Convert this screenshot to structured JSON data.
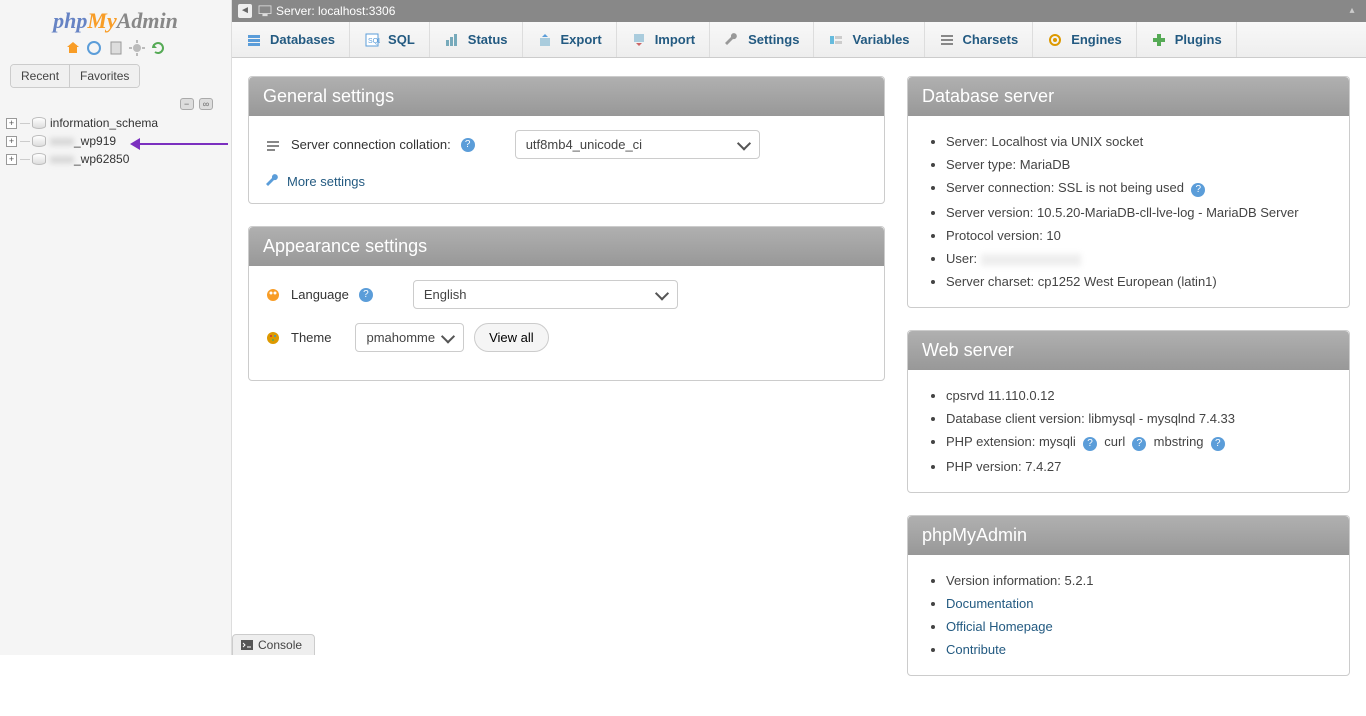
{
  "logo": {
    "php": "php",
    "my": "My",
    "admin": "Admin"
  },
  "sidebar": {
    "tabs": {
      "recent": "Recent",
      "favorites": "Favorites"
    },
    "databases": [
      {
        "name": "information_schema",
        "prefix": ""
      },
      {
        "name": "_wp919",
        "prefix": "xxxx"
      },
      {
        "name": "_wp62850",
        "prefix": "xxxx"
      }
    ]
  },
  "topbar": {
    "server_label": "Server: localhost:3306"
  },
  "tabs": [
    {
      "label": "Databases",
      "icon": "databases"
    },
    {
      "label": "SQL",
      "icon": "sql"
    },
    {
      "label": "Status",
      "icon": "status"
    },
    {
      "label": "Export",
      "icon": "export"
    },
    {
      "label": "Import",
      "icon": "import"
    },
    {
      "label": "Settings",
      "icon": "settings"
    },
    {
      "label": "Variables",
      "icon": "variables"
    },
    {
      "label": "Charsets",
      "icon": "charsets"
    },
    {
      "label": "Engines",
      "icon": "engines"
    },
    {
      "label": "Plugins",
      "icon": "plugins"
    }
  ],
  "general": {
    "title": "General settings",
    "collation_label": "Server connection collation:",
    "collation_value": "utf8mb4_unicode_ci",
    "more": "More settings"
  },
  "appearance": {
    "title": "Appearance settings",
    "language_label": "Language",
    "language_value": "English",
    "theme_label": "Theme",
    "theme_value": "pmahomme",
    "view_all": "View all"
  },
  "db_server": {
    "title": "Database server",
    "items": [
      "Server: Localhost via UNIX socket",
      "Server type: MariaDB",
      "Server connection: SSL is not being used",
      "Server version: 10.5.20-MariaDB-cll-lve-log - MariaDB Server",
      "Protocol version: 10",
      "User:",
      "Server charset: cp1252 West European (latin1)"
    ]
  },
  "web_server": {
    "title": "Web server",
    "items": [
      "cpsrvd 11.110.0.12",
      "Database client version: libmysql - mysqlnd 7.4.33",
      "PHP extension: mysqli   curl   mbstring",
      "PHP version: 7.4.27"
    ]
  },
  "pma": {
    "title": "phpMyAdmin",
    "version": "Version information: 5.2.1",
    "links": [
      "Documentation",
      "Official Homepage",
      "Contribute"
    ]
  },
  "console": "Console"
}
